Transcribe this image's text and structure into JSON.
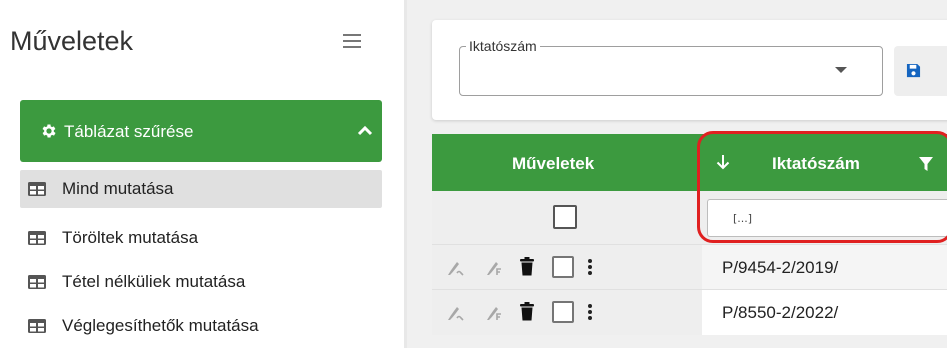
{
  "sidebar": {
    "title": "Műveletek",
    "menu_icon": "hamburger-icon",
    "filter_panel": {
      "label": "Táblázat szűrése",
      "icon": "gear-icon",
      "toggle_icon": "chevron-up-icon",
      "accent": "#3c9a3f"
    },
    "items": [
      {
        "label": "Mind mutatása",
        "icon": "table-icon",
        "active": true
      },
      {
        "label": "Töröltek mutatása",
        "icon": "table-icon",
        "active": false
      },
      {
        "label": "Tétel nélküliek mutatása",
        "icon": "table-icon",
        "active": false
      },
      {
        "label": "Véglegesíthetők mutatása",
        "icon": "table-icon",
        "active": false
      }
    ]
  },
  "search": {
    "field_label": "Iktatószám",
    "value": "",
    "dropdown_icon": "caret-down-icon",
    "save_icon": "floppy-disk-icon"
  },
  "grid": {
    "header_color": "#3c9a3f",
    "columns": {
      "actions": "Műveletek",
      "iktatoszam": "Iktatószám"
    },
    "sort_icon": "arrow-down-icon",
    "filter_icon": "funnel-icon",
    "filter_placeholder": "[...]",
    "rows": [
      {
        "iktatoszam": "P/9454-2/2019/"
      },
      {
        "iktatoszam": "P/8550-2/2022/"
      }
    ],
    "highlight_color": "#e02020"
  }
}
